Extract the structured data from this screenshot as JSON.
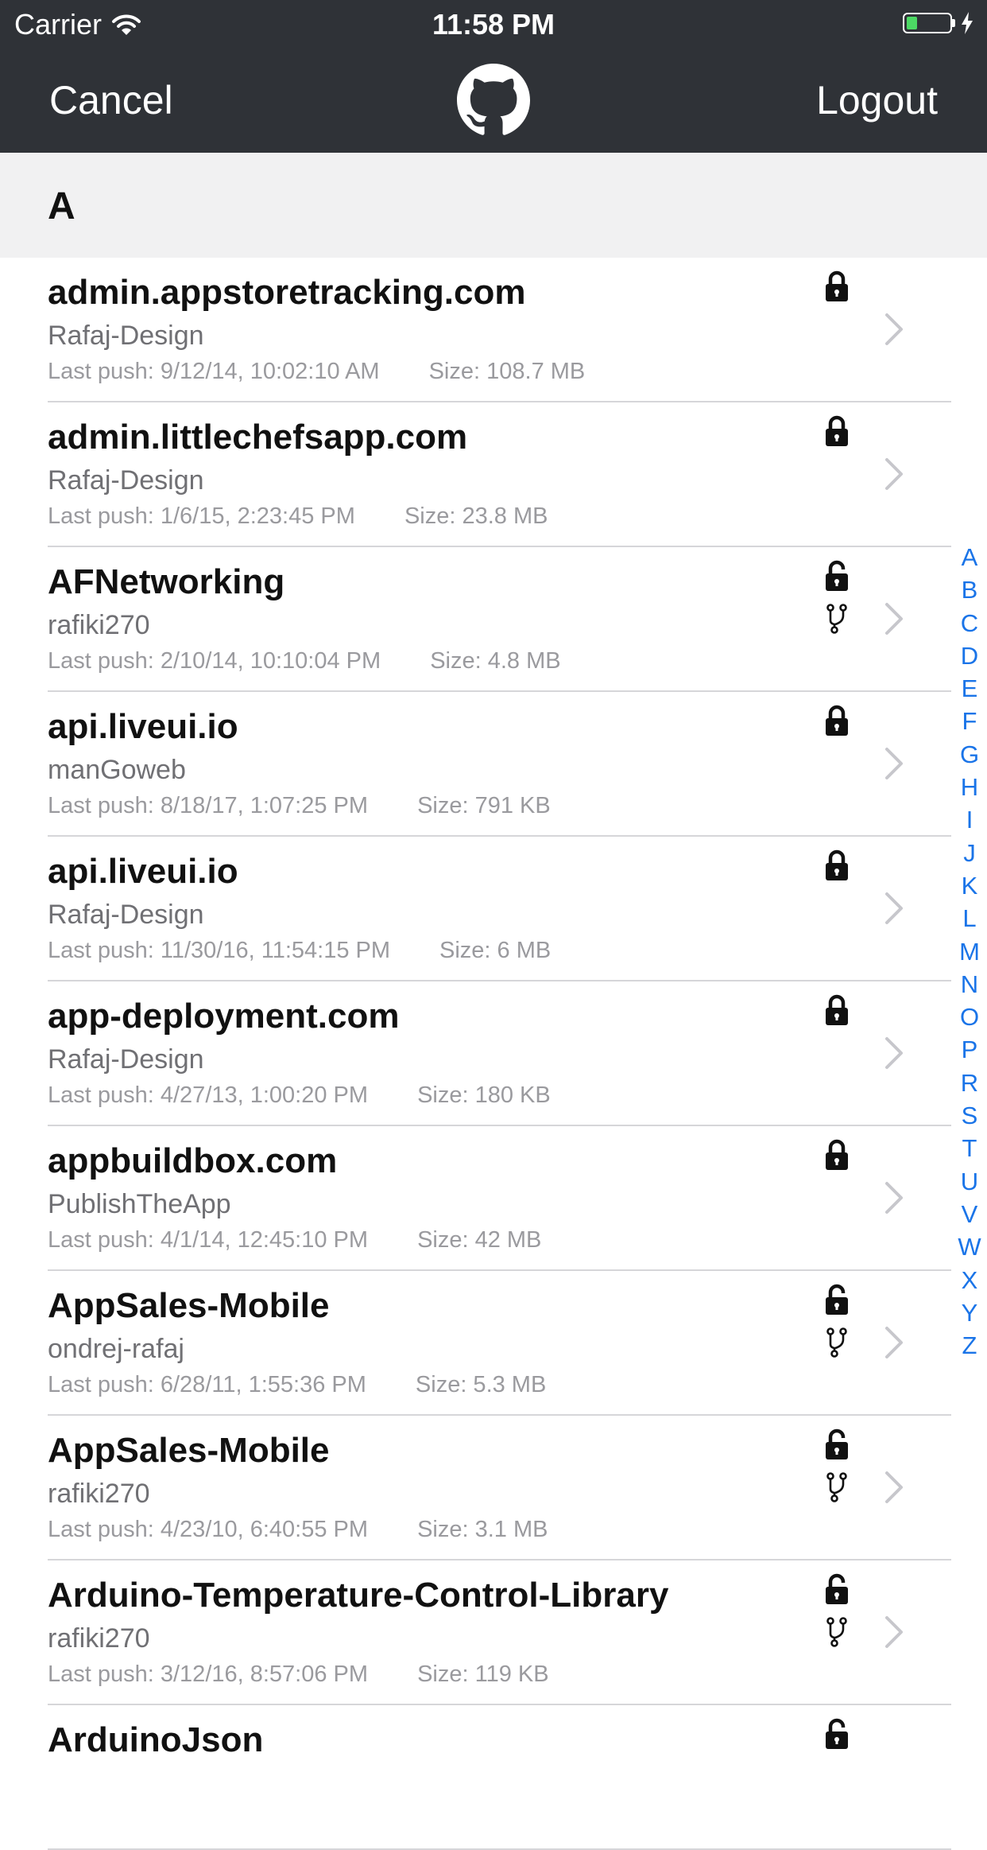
{
  "status_bar": {
    "carrier": "Carrier",
    "time": "11:58 PM",
    "battery_level": 0.25,
    "battery_color": "#4cd964"
  },
  "nav": {
    "cancel_label": "Cancel",
    "logout_label": "Logout",
    "logo_icon": "github-octocat-icon",
    "background_color": "#2f3237"
  },
  "section": {
    "letter": "A"
  },
  "repos": [
    {
      "name": "admin.appstoretracking.com",
      "owner": "Rafaj-Design",
      "last_push": "Last push: 9/12/14, 10:02:10 AM",
      "size": "Size: 108.7 MB",
      "lock": "locked",
      "fork": false
    },
    {
      "name": "admin.littlechefsapp.com",
      "owner": "Rafaj-Design",
      "last_push": "Last push: 1/6/15, 2:23:45 PM",
      "size": "Size: 23.8 MB",
      "lock": "locked",
      "fork": false
    },
    {
      "name": "AFNetworking",
      "owner": "rafiki270",
      "last_push": "Last push: 2/10/14, 10:10:04 PM",
      "size": "Size: 4.8 MB",
      "lock": "unlocked",
      "fork": true
    },
    {
      "name": "api.liveui.io",
      "owner": "manGoweb",
      "last_push": "Last push: 8/18/17, 1:07:25 PM",
      "size": "Size: 791 KB",
      "lock": "locked",
      "fork": false
    },
    {
      "name": "api.liveui.io",
      "owner": "Rafaj-Design",
      "last_push": "Last push: 11/30/16, 11:54:15 PM",
      "size": "Size: 6 MB",
      "lock": "locked",
      "fork": false
    },
    {
      "name": "app-deployment.com",
      "owner": "Rafaj-Design",
      "last_push": "Last push: 4/27/13, 1:00:20 PM",
      "size": "Size: 180 KB",
      "lock": "locked",
      "fork": false
    },
    {
      "name": "appbuildbox.com",
      "owner": "PublishTheApp",
      "last_push": "Last push: 4/1/14, 12:45:10 PM",
      "size": "Size: 42 MB",
      "lock": "locked",
      "fork": false
    },
    {
      "name": "AppSales-Mobile",
      "owner": "ondrej-rafaj",
      "last_push": "Last push: 6/28/11, 1:55:36 PM",
      "size": "Size: 5.3 MB",
      "lock": "unlocked",
      "fork": true
    },
    {
      "name": "AppSales-Mobile",
      "owner": "rafiki270",
      "last_push": "Last push: 4/23/10, 6:40:55 PM",
      "size": "Size: 3.1 MB",
      "lock": "unlocked",
      "fork": true
    },
    {
      "name": "Arduino-Temperature-Control-Library",
      "owner": "rafiki270",
      "last_push": "Last push: 3/12/16, 8:57:06 PM",
      "size": "Size: 119 KB",
      "lock": "unlocked",
      "fork": true
    },
    {
      "name": "ArduinoJson",
      "owner": "",
      "last_push": "",
      "size": "",
      "lock": "unlocked",
      "fork": false
    }
  ],
  "index_letters": [
    "A",
    "B",
    "C",
    "D",
    "E",
    "F",
    "G",
    "H",
    "I",
    "J",
    "K",
    "L",
    "M",
    "N",
    "O",
    "P",
    "R",
    "S",
    "T",
    "U",
    "V",
    "W",
    "X",
    "Y",
    "Z"
  ],
  "index_color": "#1a74e8"
}
